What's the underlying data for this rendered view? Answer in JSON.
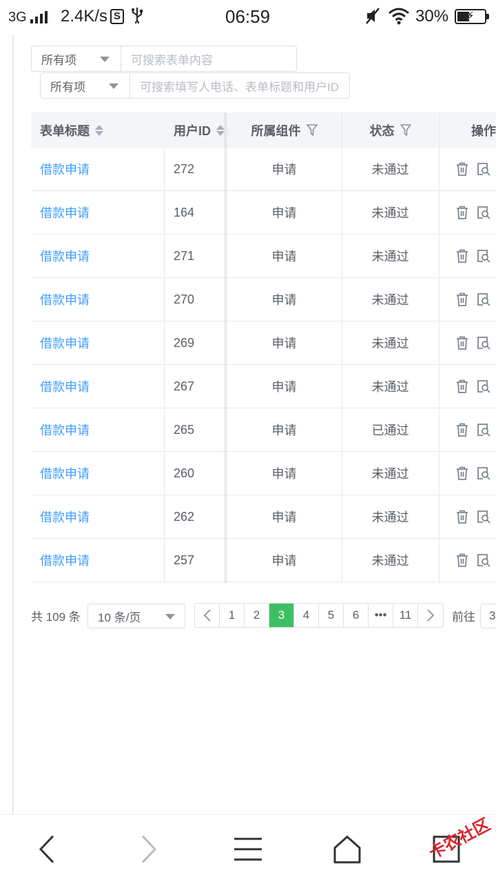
{
  "status_bar": {
    "network": "3G",
    "speed": "2.4K/s",
    "time": "06:59",
    "battery": "30%"
  },
  "filters": [
    {
      "select": "所有项",
      "placeholder": "可搜索表单内容"
    },
    {
      "select": "所有项",
      "placeholder": "可搜索填写人电话、表单标题和用户ID"
    }
  ],
  "table": {
    "headers": {
      "title": "表单标题",
      "user_id": "用户ID",
      "component": "所属组件",
      "status": "状态",
      "actions": "操作"
    },
    "rows": [
      {
        "title": "借款申请",
        "user_id": "272",
        "component": "申请",
        "status": "未通过"
      },
      {
        "title": "借款申请",
        "user_id": "164",
        "component": "申请",
        "status": "未通过"
      },
      {
        "title": "借款申请",
        "user_id": "271",
        "component": "申请",
        "status": "未通过"
      },
      {
        "title": "借款申请",
        "user_id": "270",
        "component": "申请",
        "status": "未通过"
      },
      {
        "title": "借款申请",
        "user_id": "269",
        "component": "申请",
        "status": "未通过"
      },
      {
        "title": "借款申请",
        "user_id": "267",
        "component": "申请",
        "status": "未通过"
      },
      {
        "title": "借款申请",
        "user_id": "265",
        "component": "申请",
        "status": "已通过"
      },
      {
        "title": "借款申请",
        "user_id": "260",
        "component": "申请",
        "status": "未通过"
      },
      {
        "title": "借款申请",
        "user_id": "262",
        "component": "申请",
        "status": "未通过"
      },
      {
        "title": "借款申请",
        "user_id": "257",
        "component": "申请",
        "status": "未通过"
      }
    ]
  },
  "pagination": {
    "total": "共 109 条",
    "page_size": "10 条/页",
    "pages": [
      "1",
      "2",
      "3",
      "4",
      "5",
      "6",
      "•••",
      "11"
    ],
    "current": "3",
    "goto_label": "前往",
    "goto_value": "3"
  },
  "watermark": "卡农社区",
  "colors": {
    "link": "#409eff",
    "active_page": "#3cc063",
    "header_bg": "#f3f5f8",
    "border": "#e6e8ec"
  }
}
